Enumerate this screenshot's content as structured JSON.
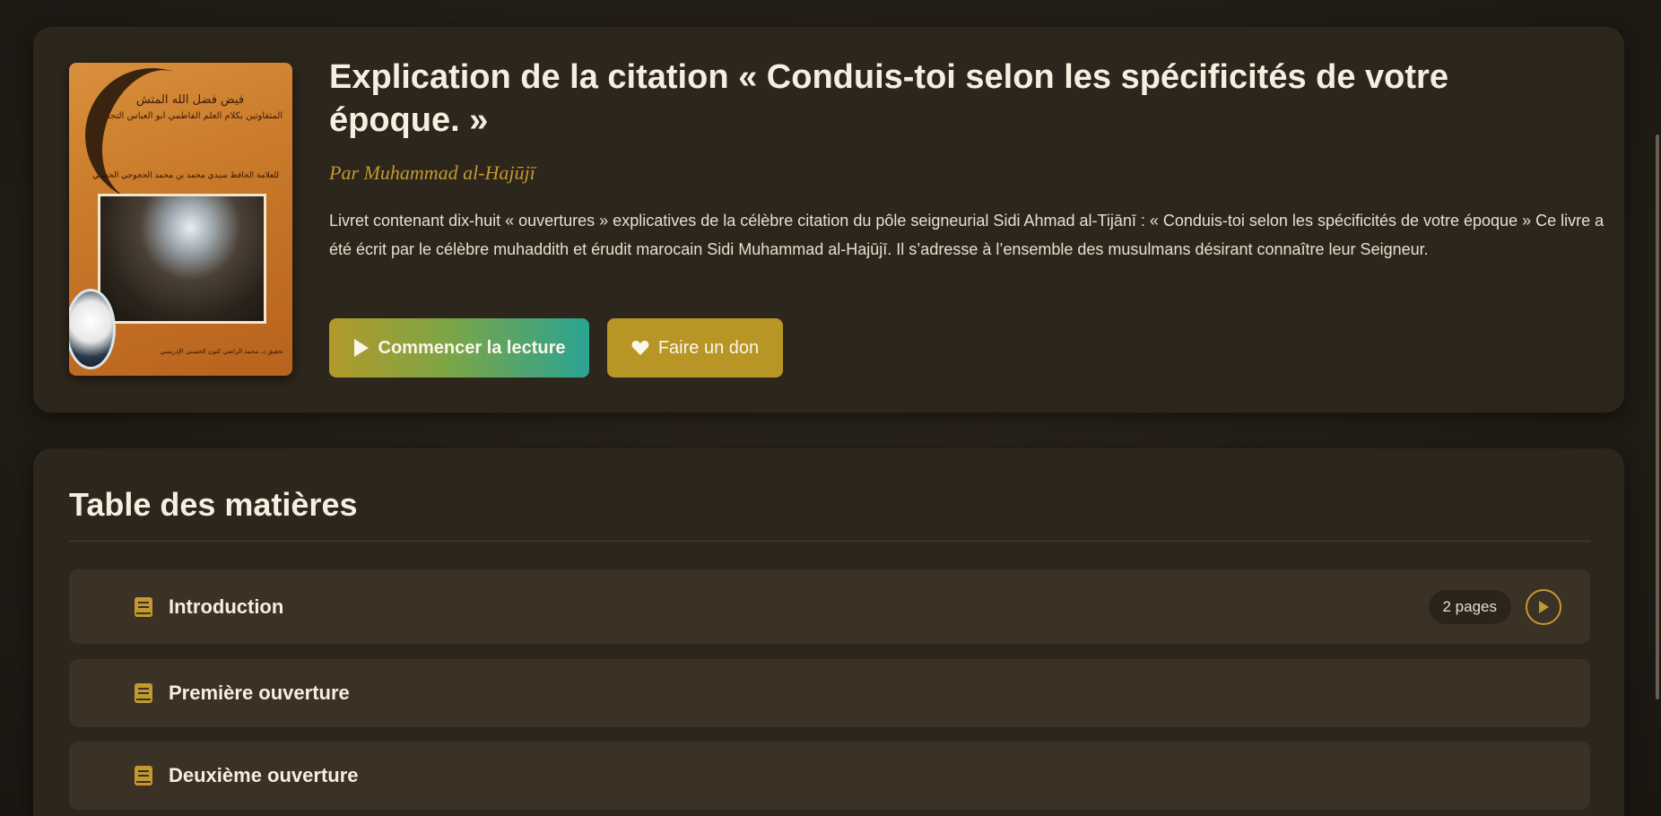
{
  "book": {
    "title": "Explication de la citation « Conduis-toi selon les spécificités de votre époque. »",
    "author": "Par Muhammad al-Hajūjī",
    "description": "Livret contenant dix-huit « ouvertures » explicatives de la célèbre citation du pôle seigneurial Sidi Ahmad al-Tijānī : « Conduis-toi selon les spécificités de votre époque » Ce livre a été écrit par le célèbre muhaddith et érudit marocain Sidi Muhammad al-Hajūjī. Il s’adresse à l’ensemble des musulmans désirant connaître leur Seigneur.",
    "cover": {
      "title_ar": "فيض فضل الله المتش",
      "subtitle_ar": "المتفاوتين بكلام العلم الفاطمي ابو العباس التجاني",
      "author_ar": "للعلامة الحافظ سيدي محمد بن محمد الحجوجي الحسني",
      "footer_ar": "تحقيق د. محمد الراضي كنون الحسني الإدريسي"
    }
  },
  "actions": {
    "read_label": "Commencer la lecture",
    "donate_label": "Faire un don"
  },
  "toc": {
    "heading": "Table des matières",
    "chapters": [
      {
        "label": "Introduction",
        "pages": "2 pages"
      },
      {
        "label": "Première ouverture"
      },
      {
        "label": "Deuxième ouverture"
      }
    ]
  },
  "colors": {
    "accent_gold": "#c2992f",
    "card_bg": "#2d261c",
    "row_bg": "#3b3225",
    "read_gradient_start": "#b19a2a",
    "read_gradient_end": "#2aa493"
  },
  "icons": [
    "play-icon",
    "heart-icon",
    "book-icon",
    "play-circle-icon"
  ]
}
